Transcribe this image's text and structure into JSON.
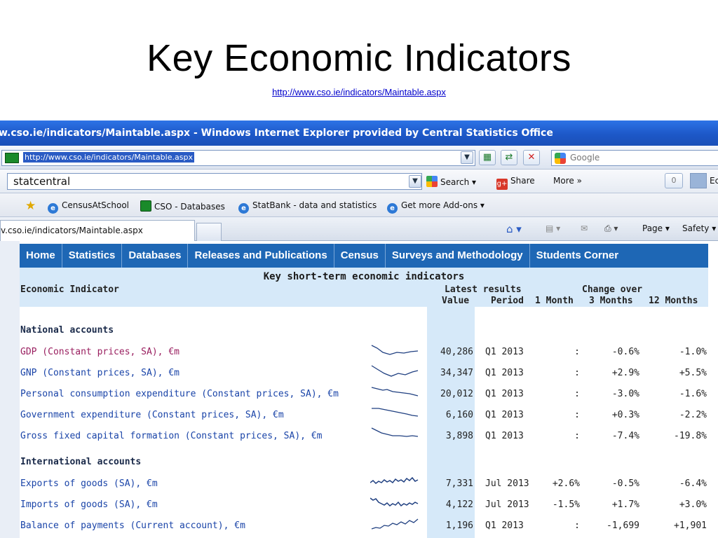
{
  "slide": {
    "title": "Key Economic Indicators",
    "link": "http://www.cso.ie/indicators/Maintable.aspx"
  },
  "browser": {
    "window_title": "w.cso.ie/indicators/Maintable.aspx - Windows Internet Explorer provided by Central Statistics Office",
    "address": "http://www.cso.ie/indicators/Maintable.aspx",
    "google_placeholder": "Google",
    "search_value": "statcentral",
    "toolbar": {
      "search_label": "Search",
      "share_label": "Share",
      "more_label": "More »",
      "counter": "0",
      "user_partial": "Ec"
    },
    "favorites": [
      "CensusAtSchool",
      "CSO - Databases",
      "StatBank - data and statistics",
      "Get more Add-ons"
    ],
    "tab_label": "v.cso.ie/indicators/Maintable.aspx",
    "command_bar": {
      "page_label": "Page",
      "safety_label": "Safety"
    }
  },
  "site": {
    "nav": [
      "Home",
      "Statistics",
      "Databases",
      "Releases and Publications",
      "Census",
      "Surveys and Methodology",
      "Students Corner"
    ],
    "table": {
      "title": "Key short-term economic indicators",
      "col_indicator": "Economic Indicator",
      "col_latest": "Latest results",
      "col_change": "Change over",
      "col_value": "Value",
      "col_period": "Period",
      "col_1m": "1 Month",
      "col_3m": "3 Months",
      "col_12m": "12 Months",
      "sections": [
        {
          "name": "National accounts",
          "rows": [
            {
              "name": "GDP (Constant prices, SA), €m",
              "value": "40,286",
              "period": "Q1 2013",
              "m1": ":",
              "m3": "-0.6%",
              "m12": "-1.0%"
            },
            {
              "name": "GNP (Constant prices, SA), €m",
              "value": "34,347",
              "period": "Q1 2013",
              "m1": ":",
              "m3": "+2.9%",
              "m12": "+5.5%"
            },
            {
              "name": "Personal consumption expenditure (Constant prices, SA), €m",
              "value": "20,012",
              "period": "Q1 2013",
              "m1": ":",
              "m3": "-3.0%",
              "m12": "-1.6%"
            },
            {
              "name": "Government expenditure (Constant prices, SA), €m",
              "value": "6,160",
              "period": "Q1 2013",
              "m1": ":",
              "m3": "+0.3%",
              "m12": "-2.2%"
            },
            {
              "name": "Gross fixed capital formation (Constant prices, SA), €m",
              "value": "3,898",
              "period": "Q1 2013",
              "m1": ":",
              "m3": "-7.4%",
              "m12": "-19.8%"
            }
          ]
        },
        {
          "name": "International accounts",
          "rows": [
            {
              "name": "Exports of goods (SA), €m",
              "value": "7,331",
              "period": "Jul 2013",
              "m1": "+2.6%",
              "m3": "-0.5%",
              "m12": "-6.4%"
            },
            {
              "name": "Imports of goods (SA), €m",
              "value": "4,122",
              "period": "Jul 2013",
              "m1": "-1.5%",
              "m3": "+1.7%",
              "m12": "+3.0%"
            },
            {
              "name": "Balance of payments (Current account), €m",
              "value": "1,196",
              "period": "Q1 2013",
              "m1": ":",
              "m3": "-1,699",
              "m12": "+1,901"
            }
          ]
        }
      ]
    }
  },
  "colors": {
    "nav_bg": "#1e67b5",
    "header_bg": "#d6e9f9",
    "indicator_link": "#1a44a8",
    "titlebar": "#1d58c8"
  }
}
